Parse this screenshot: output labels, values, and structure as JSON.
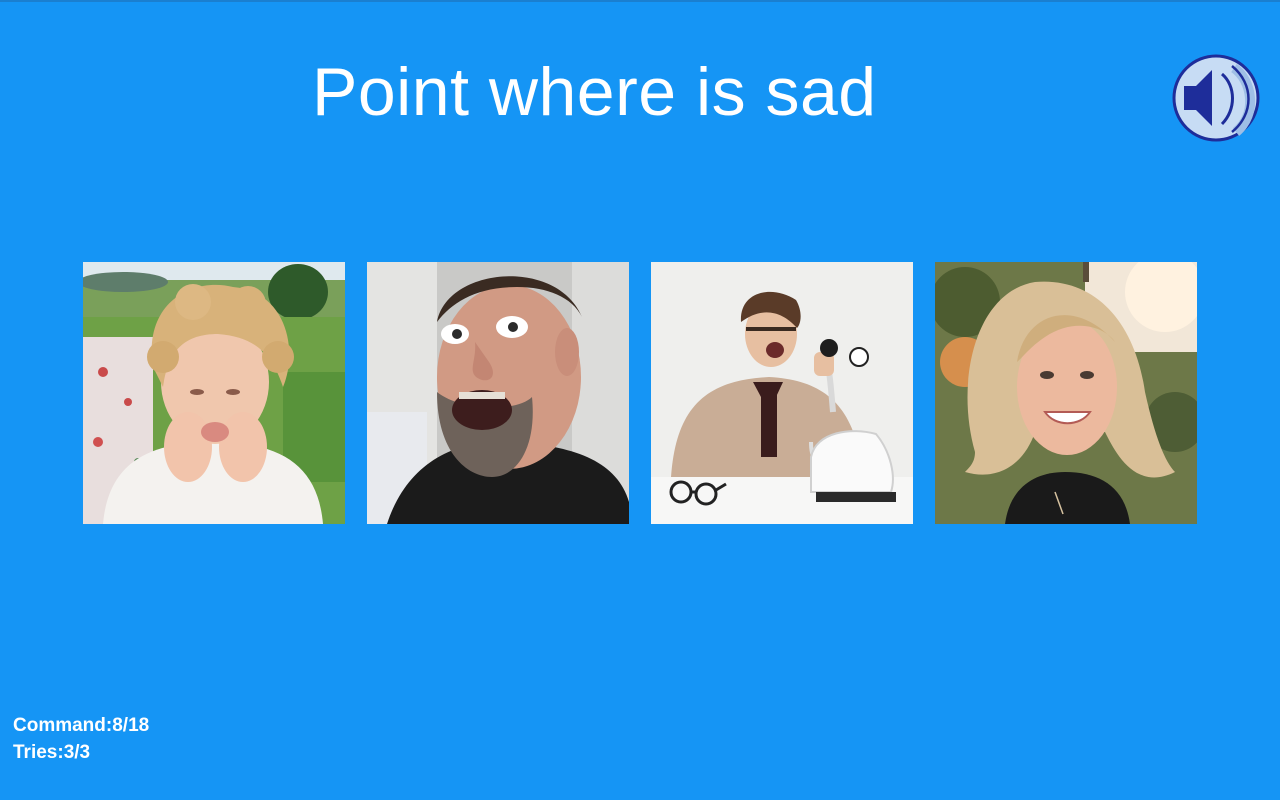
{
  "prompt": {
    "title": "Point where is sad"
  },
  "audio": {
    "icon": "speaker-icon"
  },
  "choices": [
    {
      "subject": "crying child",
      "icon": "photo-sad-child"
    },
    {
      "subject": "shocked man",
      "icon": "photo-shocked-man"
    },
    {
      "subject": "shouting man on phone",
      "icon": "photo-angry-man-phone"
    },
    {
      "subject": "smiling woman",
      "icon": "photo-happy-woman"
    }
  ],
  "status": {
    "command": "Command:8/18",
    "tries": "Tries:3/3"
  },
  "colors": {
    "background": "#1595f5",
    "speaker_fill": "#c7dcf4",
    "speaker_stroke": "#1e2d9a"
  }
}
